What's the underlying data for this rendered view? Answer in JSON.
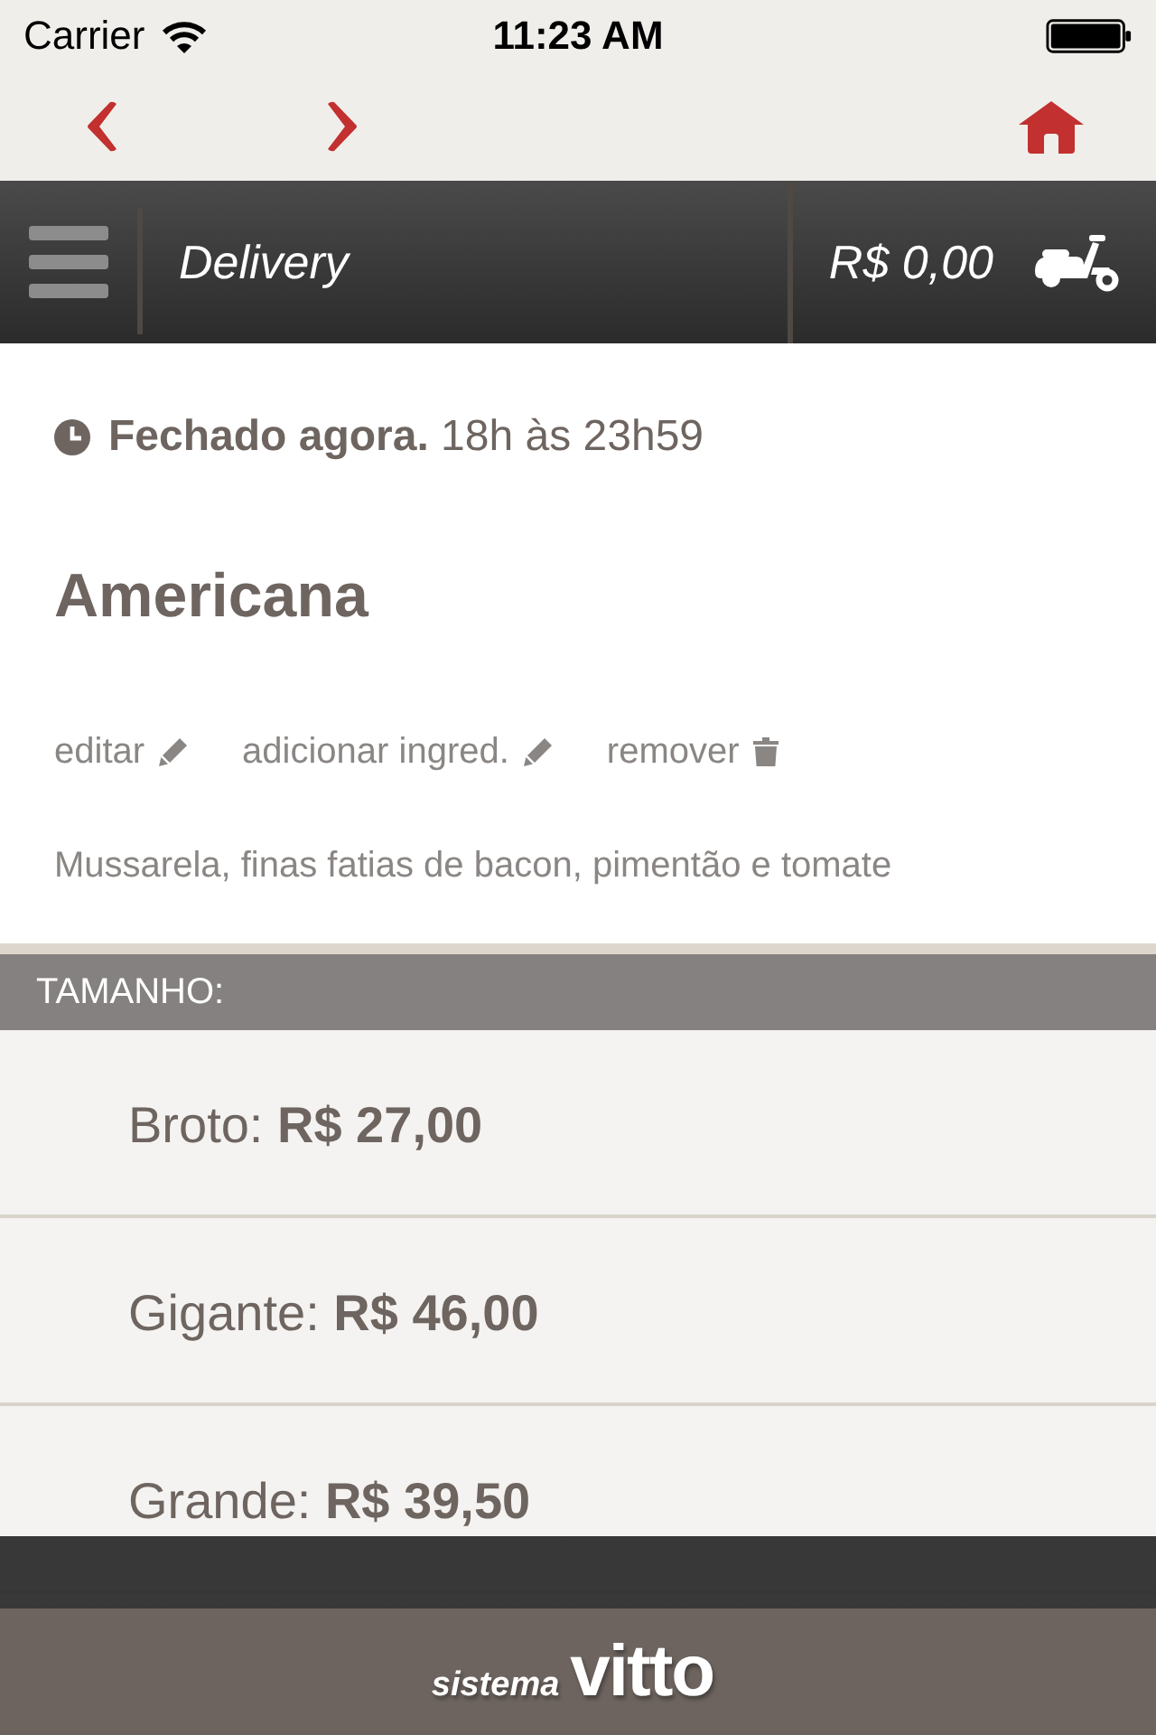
{
  "status_bar": {
    "carrier": "Carrier",
    "time": "11:23 AM"
  },
  "header": {
    "title": "Delivery",
    "cart_total": "R$ 0,00"
  },
  "store_status": "**Fechado agora.** 18h às 23h59",
  "product": {
    "name": "Americana",
    "actions": [
      {
        "label": "editar",
        "kind": "edit"
      },
      {
        "label": "adicionar ingred.",
        "kind": "edit"
      },
      {
        "label": "remover",
        "kind": "remove"
      }
    ],
    "description": "Mussarela, finas fatias de bacon, pimentão e tomate"
  },
  "size_section": {
    "title": "TAMANHO:",
    "options": [
      {
        "text": "Broto: **R$ 27,00**"
      },
      {
        "text": "Gigante: **R$ 46,00**"
      },
      {
        "text": "Grande: **R$ 39,50**"
      }
    ]
  },
  "footer": {
    "logo_prefix": "sistema",
    "logo_name": "vitto"
  }
}
